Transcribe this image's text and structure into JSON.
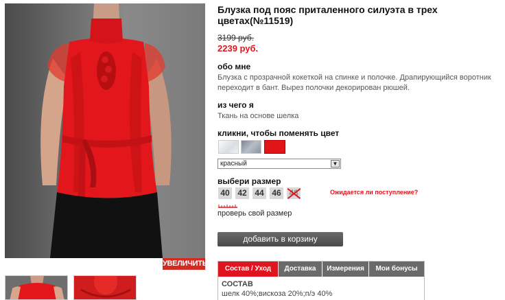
{
  "product": {
    "title": "Блузка под пояс приталенного силуэта в трех цветах(№11519)",
    "old_price": "3199 руб.",
    "new_price": "2239 руб."
  },
  "gallery": {
    "zoom_label": "УВЕЛИЧИТЬ"
  },
  "about": {
    "heading": "обо мне",
    "text": "Блузка с прозрачной кокеткой на спинке и полочке. Драпирующийся воротник переходит в бант. Вырез полочки декорирован рюшей."
  },
  "material": {
    "heading": "из чего я",
    "text": "Ткань на основе шелка"
  },
  "colors": {
    "heading": "кликни, чтобы поменять цвет",
    "selected": "красный",
    "swatch_colors": [
      "#e9ecef",
      "#9aa2ad",
      "#e21417"
    ]
  },
  "sizes": {
    "heading": "выбери размер",
    "items": [
      "40",
      "42",
      "44",
      "46",
      "48"
    ],
    "unavailable": [
      "48"
    ],
    "await_link": "Ожидается ли поступление?",
    "check_size": "проверь свой размер"
  },
  "cart": {
    "button_label": "добавить в корзину"
  },
  "tabs": {
    "items": [
      "Состав / Уход",
      "Доставка",
      "Измерения",
      "Мои бонусы"
    ],
    "active": "Состав / Уход",
    "content_heading": "СОСТАВ",
    "content_text": "шелк 40%;вискоза 20%;п/э 40%"
  },
  "accent_color": "#e0141e"
}
